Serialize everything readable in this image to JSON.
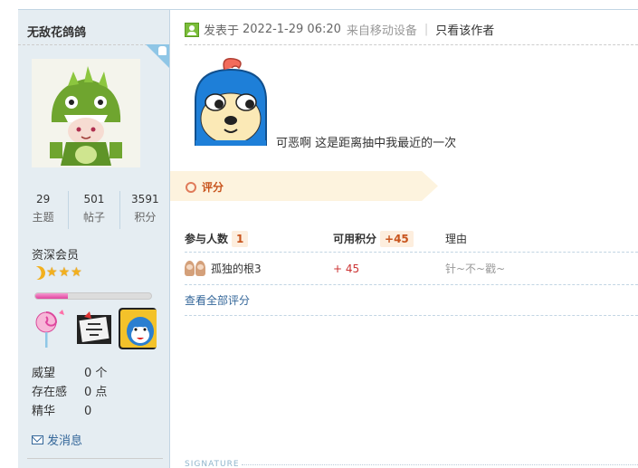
{
  "profile": {
    "username": "无敌花鸽鸽",
    "stats": [
      {
        "value": "29",
        "label": "主题"
      },
      {
        "value": "501",
        "label": "帖子"
      },
      {
        "value": "3591",
        "label": "积分"
      }
    ],
    "rank": "资深会员",
    "level_progress": 0.28,
    "info": [
      {
        "key": "威望",
        "value": "0 个"
      },
      {
        "key": "存在感",
        "value": "0 点"
      },
      {
        "key": "精华",
        "value": "0"
      }
    ],
    "send_message": "发消息",
    "icons": {
      "device": "android-corner-icon",
      "level": "moon-star-level-icons",
      "message": "envelope-icon"
    }
  },
  "post": {
    "posted_prefix": "发表于",
    "date": "2022-1-29 06:20",
    "source": "来自移动设备",
    "separator": "|",
    "only_author": "只看该作者",
    "body_text": "可恶啊 这是距离抽中我最近的一次"
  },
  "rating": {
    "title": "评分",
    "header": {
      "participants_label": "参与人数",
      "participants_count": "1",
      "points_label": "可用积分",
      "points_total": "+45",
      "reason_label": "理由"
    },
    "rows": [
      {
        "user": "孤独的根3",
        "points": "+ 45",
        "reason": "针~不~戳~"
      }
    ],
    "view_all": "查看全部评分"
  },
  "signature": {
    "label": "SIGNATURE"
  },
  "colors": {
    "sidebar_bg": "#e5edf2",
    "link": "#336699",
    "rate_accent": "#c8541d",
    "banner_bg": "#fdf3de",
    "points_red": "#cc3333"
  }
}
